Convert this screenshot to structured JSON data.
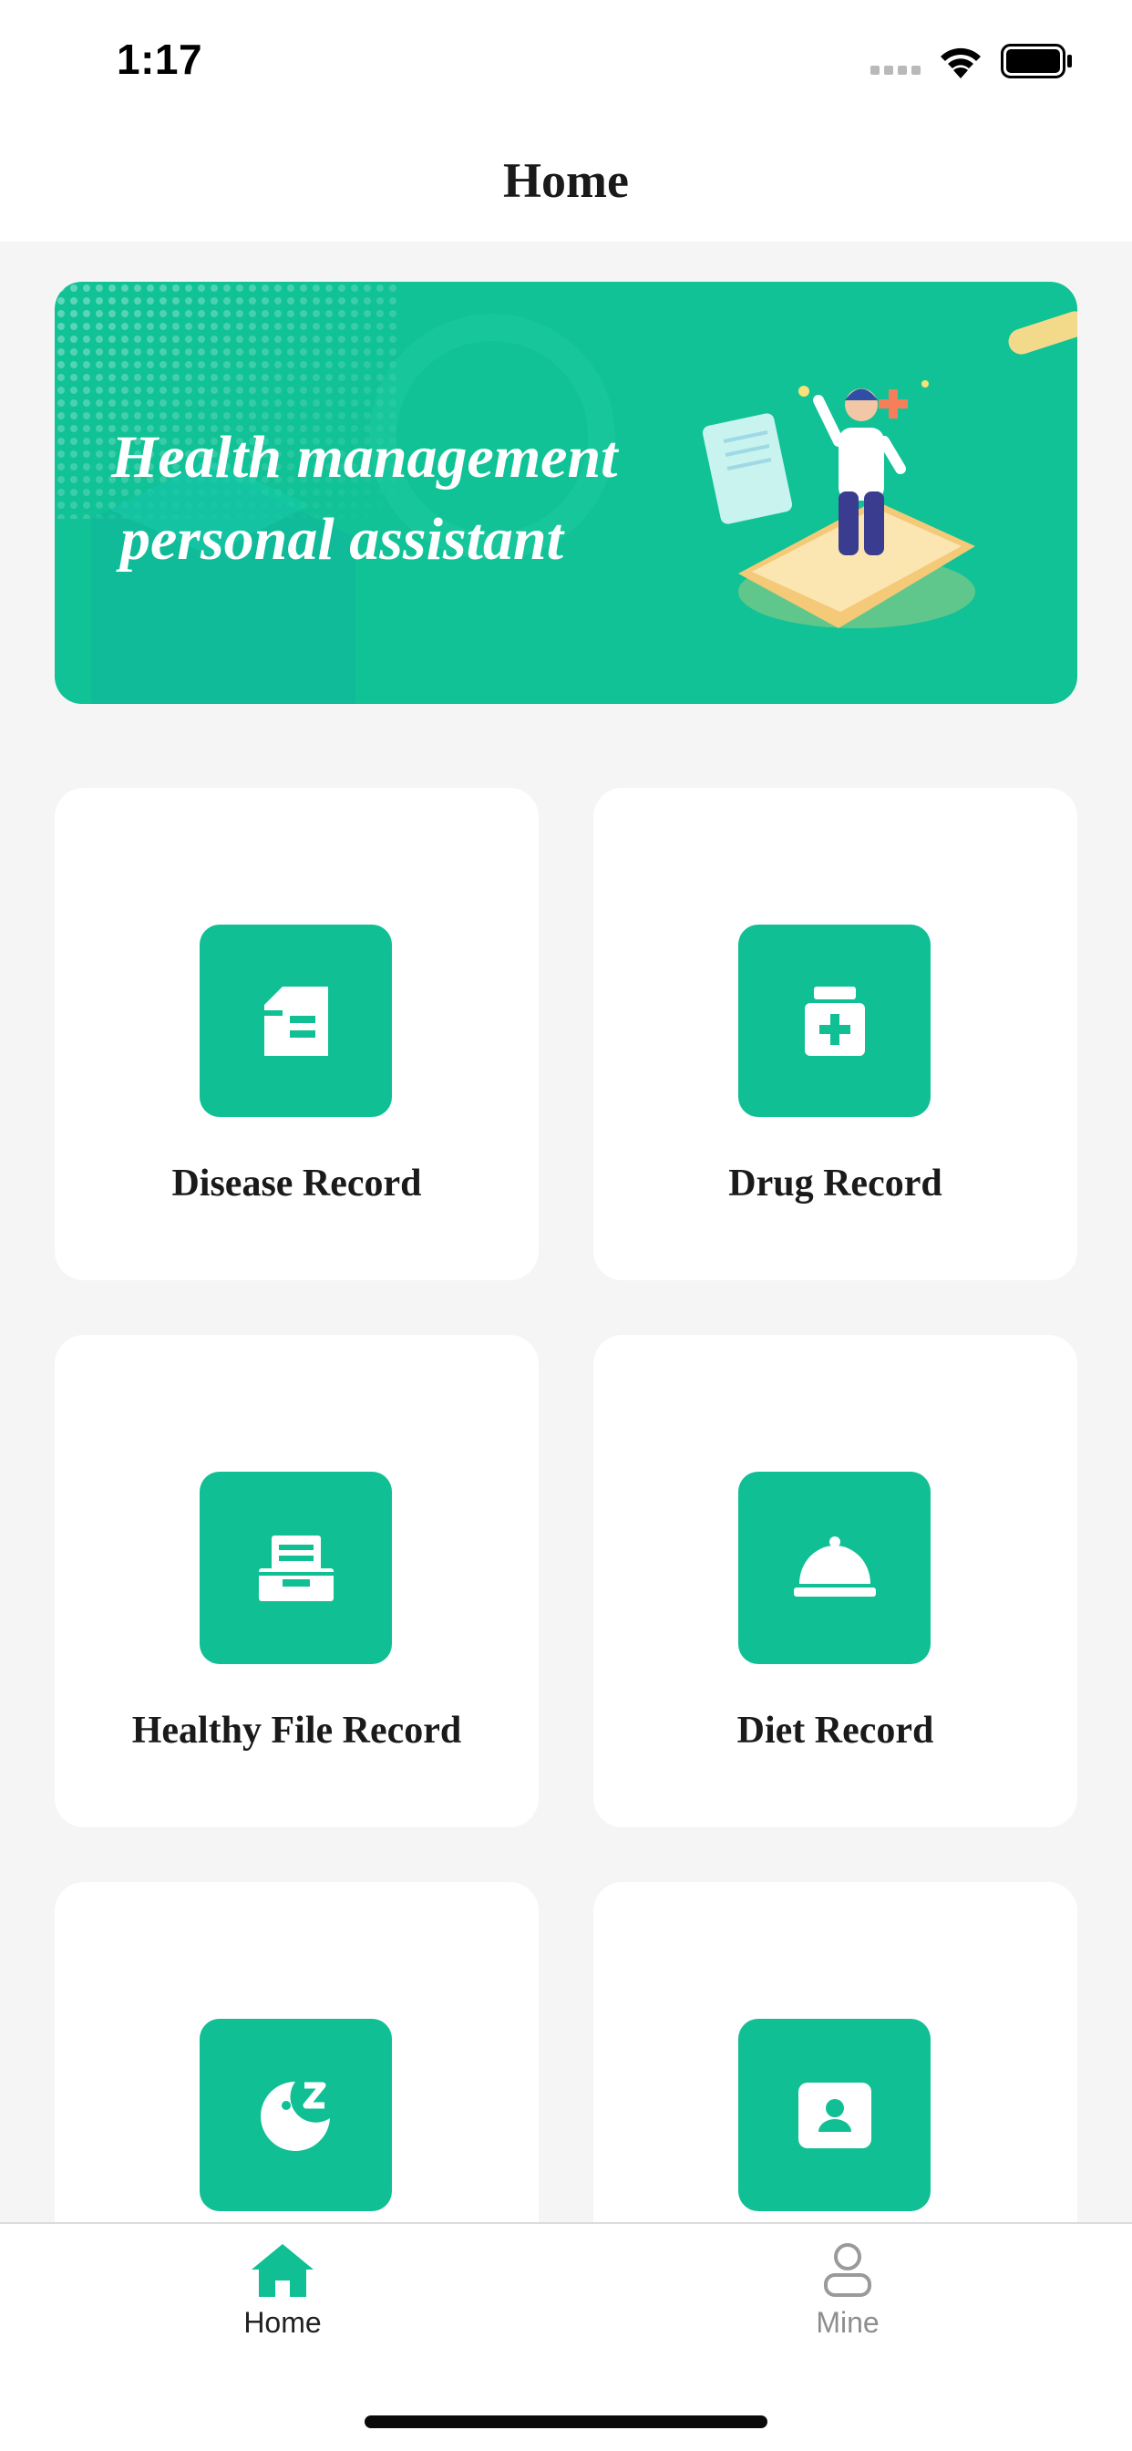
{
  "status_bar": {
    "time": "1:17"
  },
  "nav": {
    "title": "Home"
  },
  "banner": {
    "line1": "Health management",
    "line2": "personal assistant"
  },
  "cards": [
    {
      "label": "Disease Record",
      "icon": "document-icon"
    },
    {
      "label": "Drug Record",
      "icon": "medicine-bottle-icon"
    },
    {
      "label": "Healthy File Record",
      "icon": "file-box-icon"
    },
    {
      "label": "Diet Record",
      "icon": "food-cloche-icon"
    },
    {
      "label": "",
      "icon": "sleep-moon-icon"
    },
    {
      "label": "",
      "icon": "contact-card-icon"
    }
  ],
  "tabs": [
    {
      "label": "Home",
      "icon": "house-icon",
      "active": true
    },
    {
      "label": "Mine",
      "icon": "person-icon",
      "active": false
    }
  ],
  "colors": {
    "accent": "#10bf94",
    "banner": "#10c296",
    "background": "#f5f5f5"
  }
}
